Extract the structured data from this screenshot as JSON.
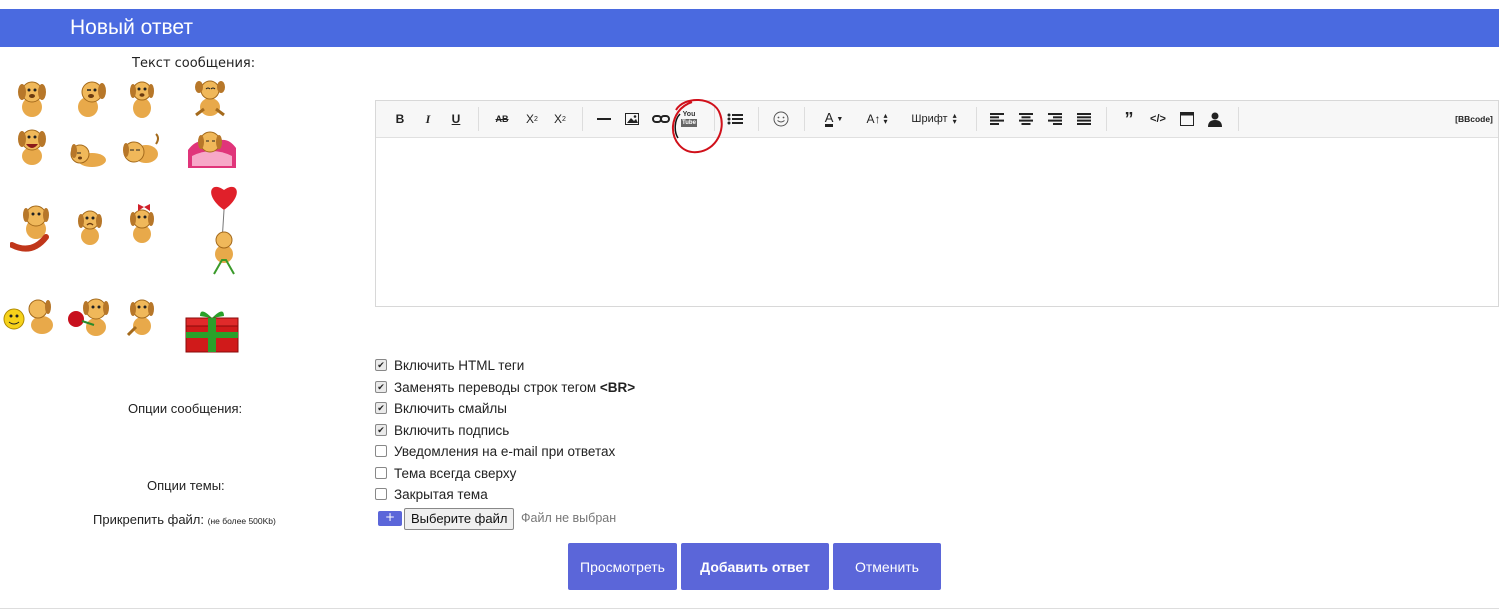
{
  "header": {
    "title": "Новый ответ"
  },
  "form": {
    "message_label": "Текст сообщения:",
    "message_options_label": "Опции сообщения:",
    "topic_options_label": "Опции темы:",
    "attach_label": "Прикрепить файл:",
    "attach_note": "(не более 500Kb)"
  },
  "smileys": {
    "count": 15
  },
  "toolbar": {
    "bold": "B",
    "italic": "I",
    "underline": "U",
    "strike": "AB",
    "superscript": "X",
    "superscript_mark": "2",
    "subscript": "X",
    "subscript_mark": "2",
    "youtube_top": "You",
    "youtube_bottom": "Tube",
    "font_size": "A↑",
    "font": "Шрифт",
    "quote": "”",
    "code": "</>",
    "bbcode": "[BBcode]"
  },
  "options": [
    {
      "label": "Включить HTML теги",
      "checked": true
    },
    {
      "label": "Заменять переводы строк тегом ",
      "bold_suffix": "<BR>",
      "checked": true
    },
    {
      "label": "Включить смайлы",
      "checked": true
    },
    {
      "label": "Включить подпись",
      "checked": true
    },
    {
      "label": "Уведомления на e-mail при ответах",
      "checked": false
    },
    {
      "label": "Тема всегда сверху",
      "checked": false
    },
    {
      "label": "Закрытая тема",
      "checked": false
    }
  ],
  "file": {
    "plus": "+",
    "choose": "Выберите файл",
    "status": "Файл не выбран"
  },
  "buttons": {
    "preview": "Просмотреть",
    "submit": "Добавить ответ",
    "cancel": "Отменить"
  },
  "colors": {
    "header": "#4a6ae0",
    "button": "#5b66d9",
    "annotation_circle": "#d0101a"
  }
}
